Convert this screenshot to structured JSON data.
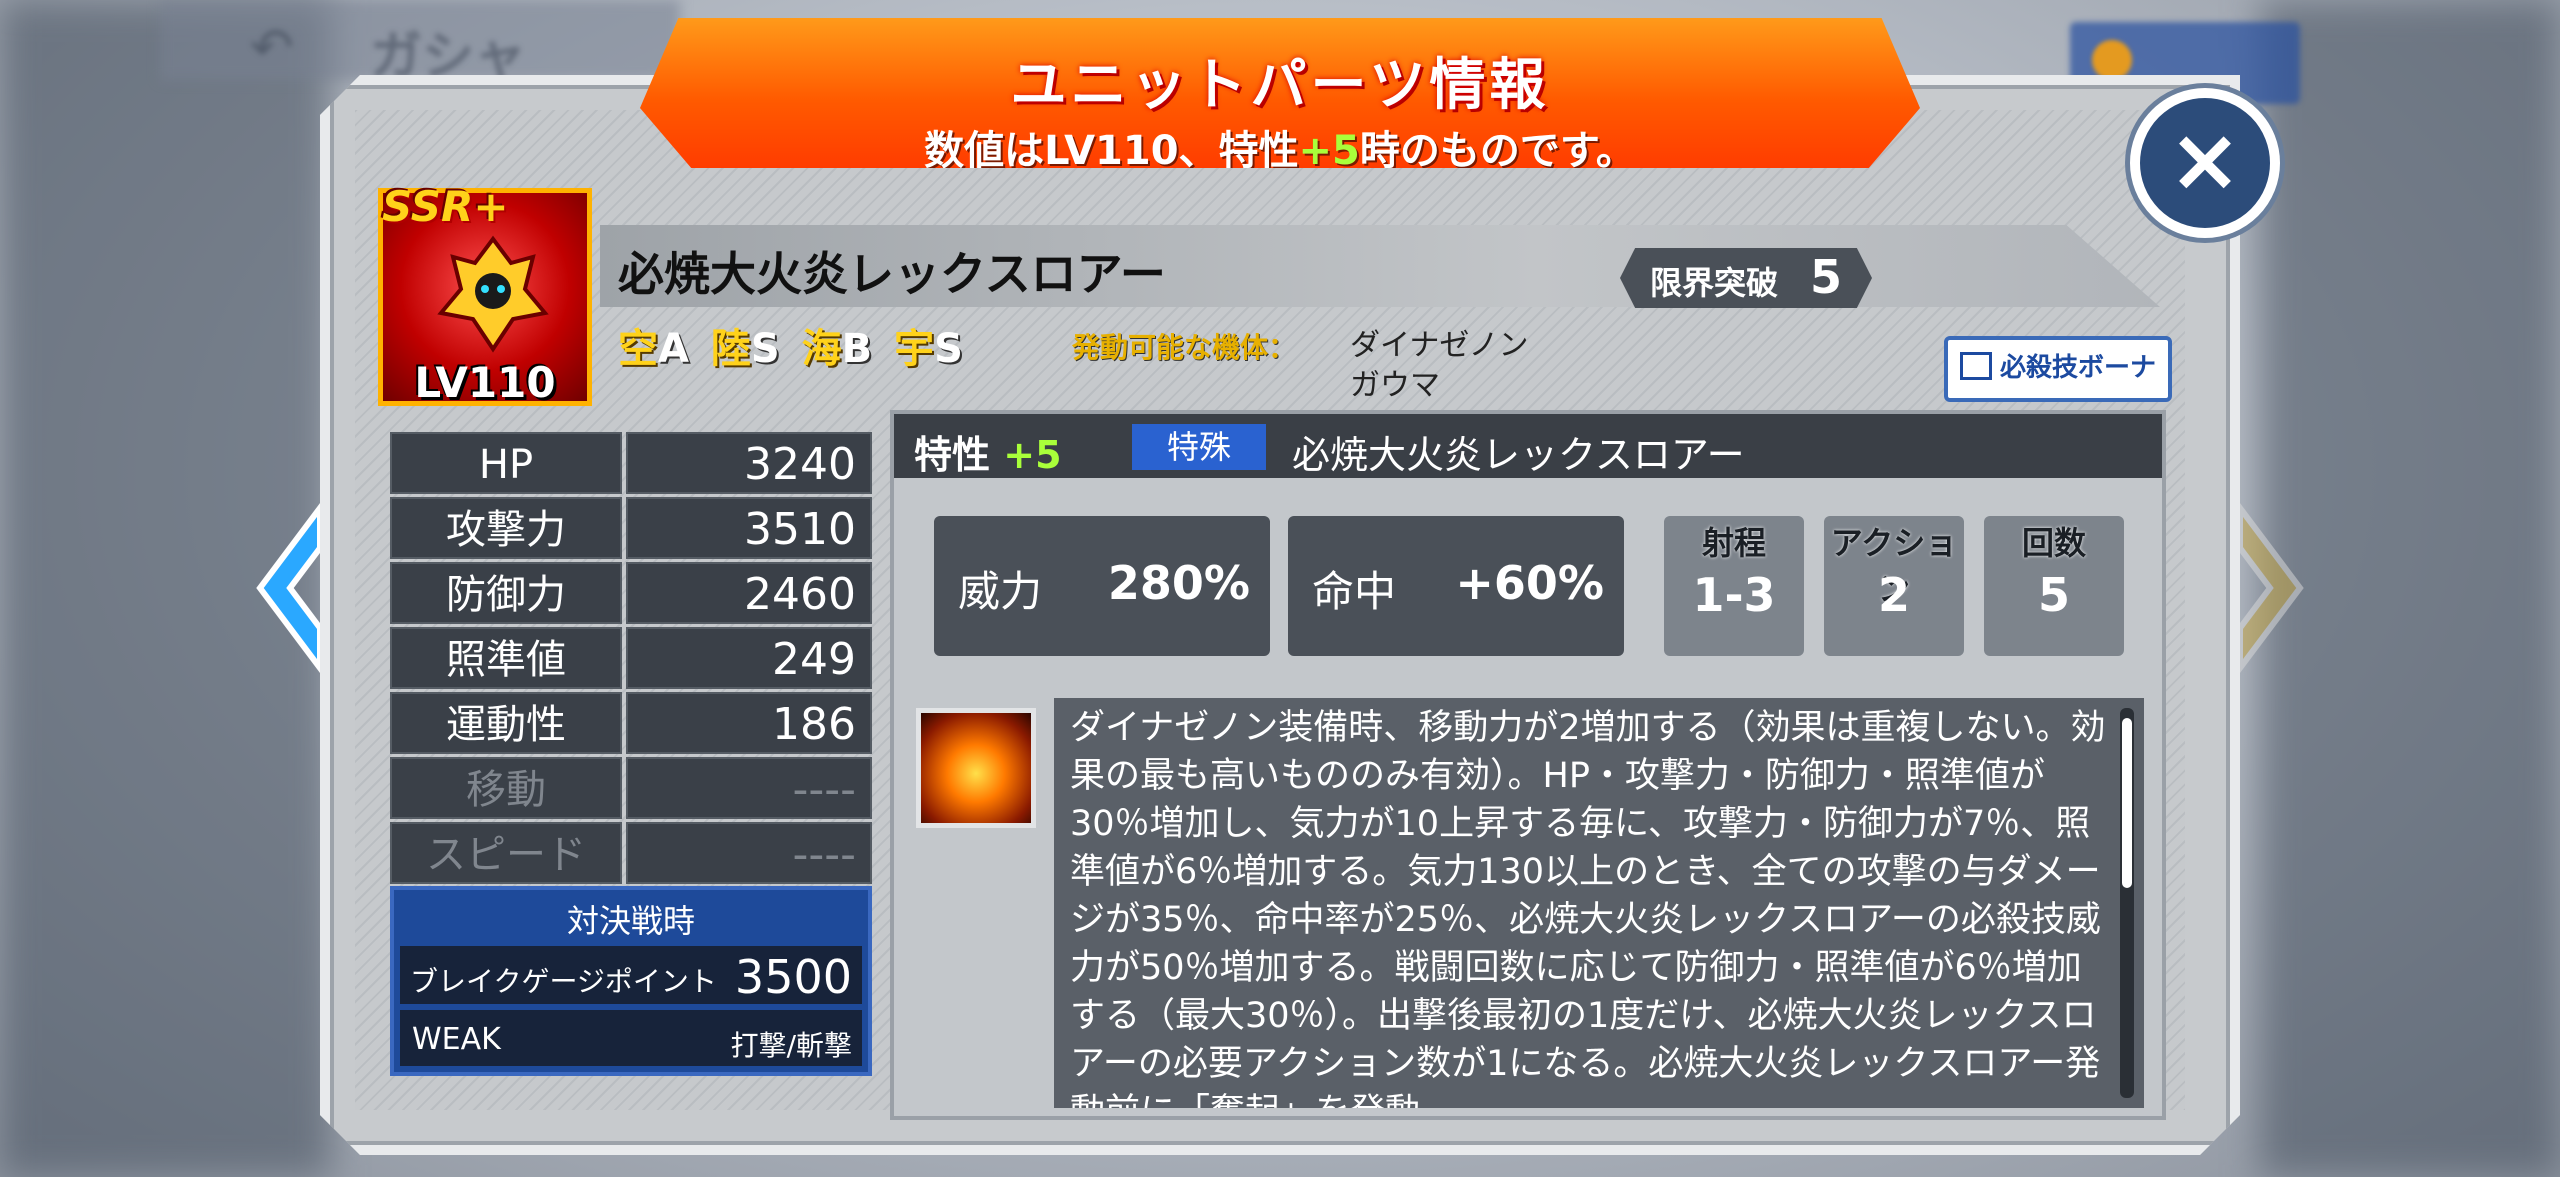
{
  "background": {
    "back_label": "↶",
    "prev_screen_title": "ガシャ"
  },
  "header": {
    "title": "ユニットパーツ情報",
    "subtitle_pre": "数値はLV110、特性",
    "subtitle_hl": "+5",
    "subtitle_post": "時のものです。"
  },
  "close_label": "×",
  "unit": {
    "rarity": "SSR+",
    "level": "LV110",
    "name": "必焼大火炎レックスロアー",
    "limit_break_label": "限界突破",
    "limit_break_value": "5",
    "terrain": [
      {
        "key": "空",
        "value": "A"
      },
      {
        "key": "陸",
        "value": "S"
      },
      {
        "key": "海",
        "value": "B"
      },
      {
        "key": "宇",
        "value": "S"
      }
    ],
    "compatible_label": "発動可能な機体：",
    "compatible_units": [
      "ダイナゼノン",
      "ガウマ"
    ],
    "bonus_button": "必殺技ボーナス"
  },
  "stats": [
    {
      "key": "HP",
      "value": "3240"
    },
    {
      "key": "攻撃力",
      "value": "3510"
    },
    {
      "key": "防御力",
      "value": "2460"
    },
    {
      "key": "照準値",
      "value": "249"
    },
    {
      "key": "運動性",
      "value": "186"
    },
    {
      "key": "移動",
      "value": "----"
    },
    {
      "key": "スピード",
      "value": "----"
    }
  ],
  "battle": {
    "title": "対決戦時",
    "break_label": "ブレイクゲージポイント",
    "break_value": "3500",
    "weak_label": "WEAK",
    "weak_value": "打撃/斬撃"
  },
  "skill": {
    "trait_label": "特性",
    "trait_value": "+5",
    "tag": "特殊",
    "name": "必焼大火炎レックスロアー",
    "power_label": "威力",
    "power_value": "280%",
    "hit_label": "命中",
    "hit_value": "+60%",
    "range_label": "射程",
    "range_value": "1-3",
    "action_label": "アクション",
    "action_value": "2",
    "count_label": "回数",
    "count_value": "5",
    "description": "ダイナゼノン装備時、移動力が2増加する（効果は重複しない。効果の最も高いもののみ有効）。HP・攻撃力・防御力・照準値が30％増加し、気力が10上昇する毎に、攻撃力・防御力が7％、照準値が6％増加する。気力130以上のとき、全ての攻撃の与ダメージが35％、命中率が25％、必焼大火炎レックスロアーの必殺技威力が50％増加する。戦闘回数に応じて防御力・照準値が6％増加する（最大30％）。出撃後最初の1度だけ、必焼大火炎レックスロアーの必要アクション数が1になる。必焼大火炎レックスロアー発動前に「奮起」を発動"
  }
}
